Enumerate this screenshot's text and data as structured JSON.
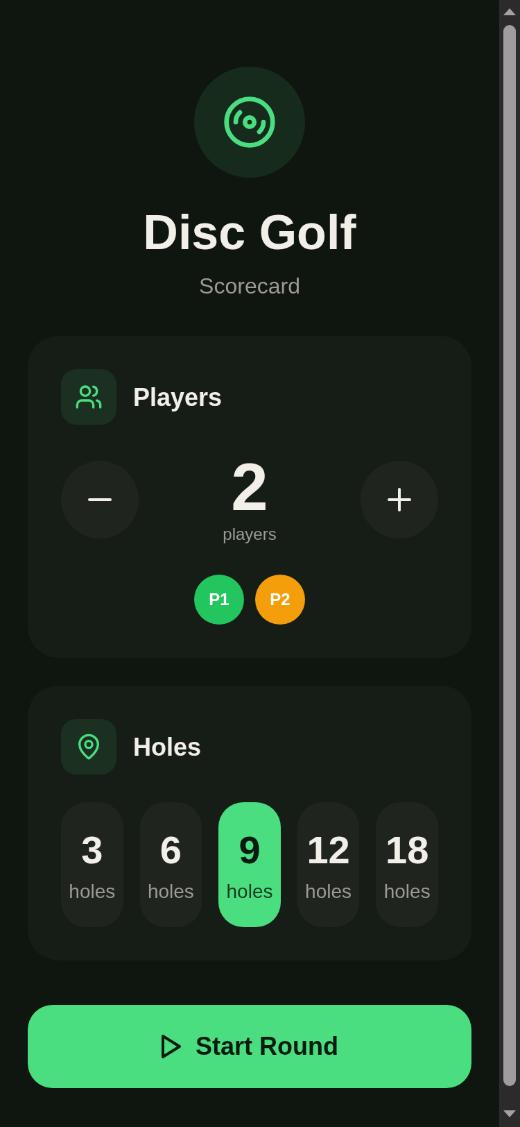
{
  "header": {
    "title": "Disc Golf",
    "subtitle": "Scorecard"
  },
  "players_card": {
    "title": "Players",
    "count": "2",
    "count_label": "players",
    "players": [
      {
        "label": "P1",
        "color": "#22c55e"
      },
      {
        "label": "P2",
        "color": "#f59e0b"
      }
    ]
  },
  "holes_card": {
    "title": "Holes",
    "options": [
      {
        "value": "3",
        "label": "holes",
        "selected": false
      },
      {
        "value": "6",
        "label": "holes",
        "selected": false
      },
      {
        "value": "9",
        "label": "holes",
        "selected": true
      },
      {
        "value": "12",
        "label": "holes",
        "selected": false
      },
      {
        "value": "18",
        "label": "holes",
        "selected": false
      }
    ]
  },
  "start_button": {
    "label": "Start Round"
  }
}
